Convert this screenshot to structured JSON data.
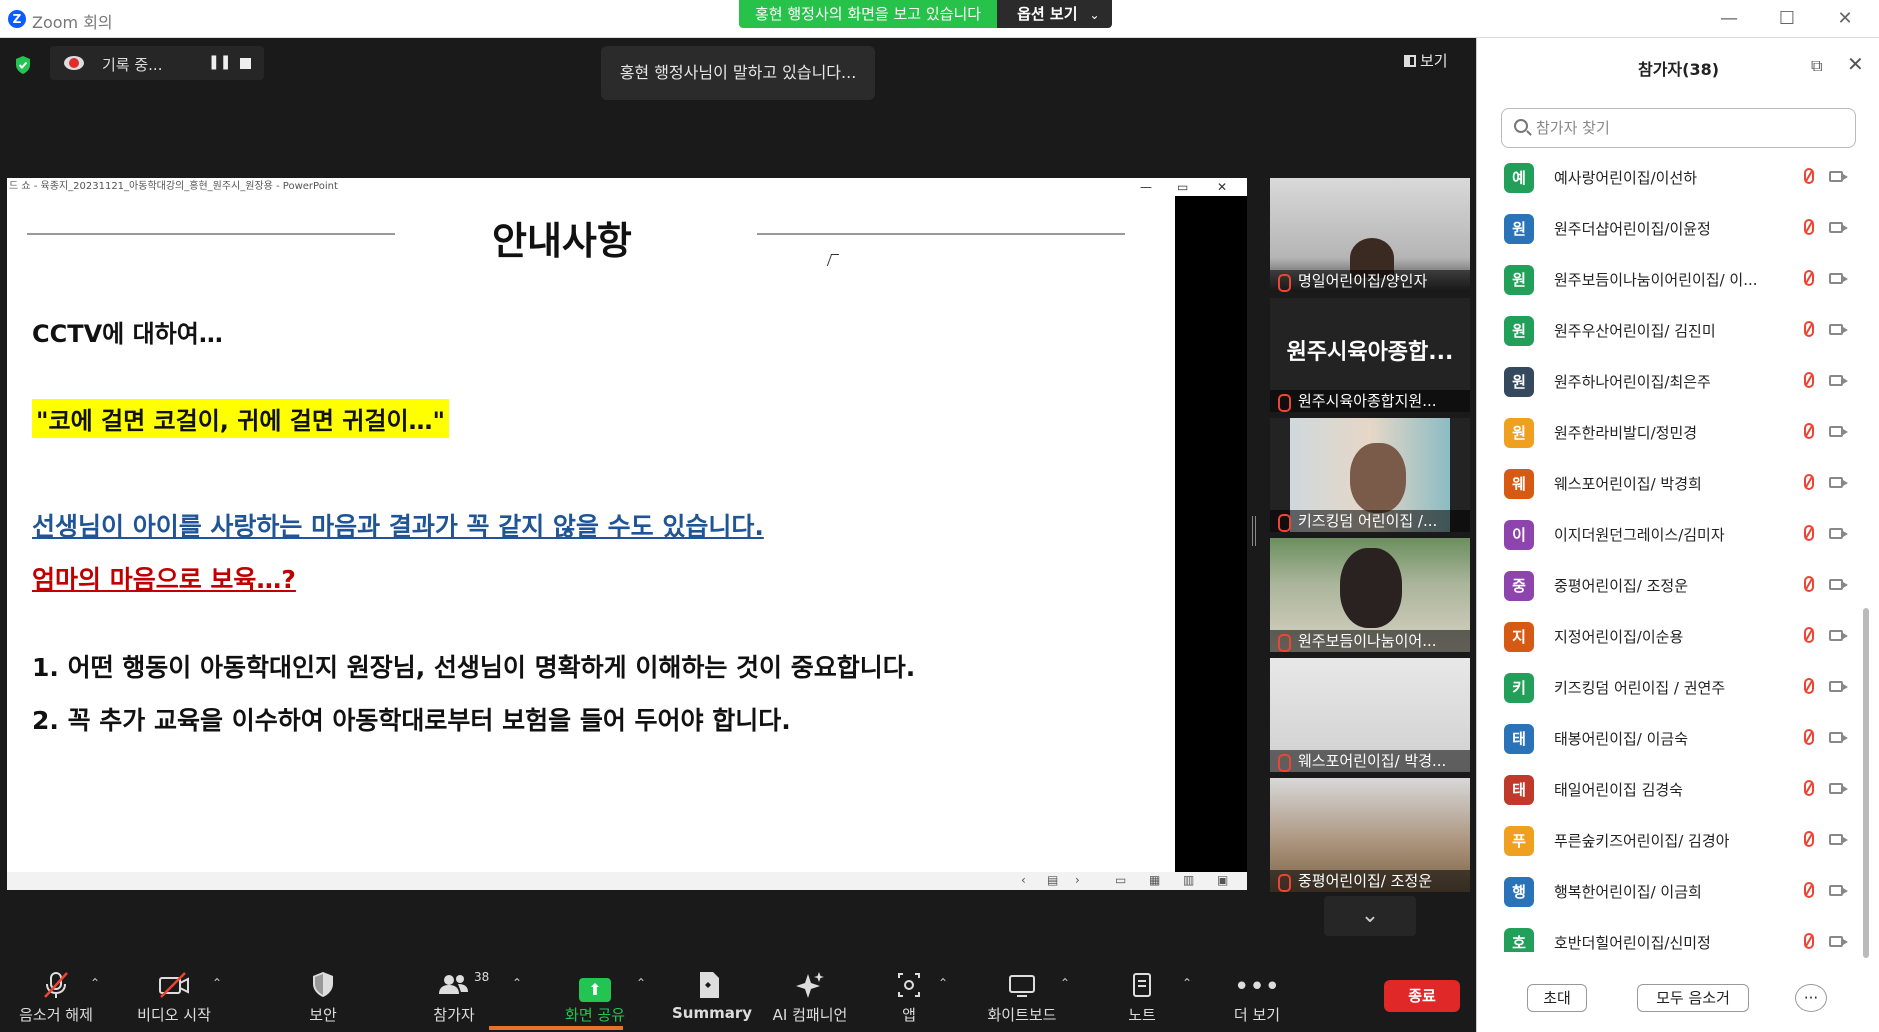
{
  "window": {
    "title": "Zoom 회의",
    "minimize": "—",
    "maximize": "☐",
    "close": "✕"
  },
  "banner": {
    "message": "홍현 행정사의 화면을 보고 있습니다",
    "options": "옵션 보기",
    "chevron": "⌄"
  },
  "recording": {
    "label": "기록 중...",
    "pause": "❚❚"
  },
  "speaking": "홍현 행정사님이 말하고 있습니다...",
  "view_button": "보기",
  "ppt": {
    "window_title": "드 쇼 - 육종지_20231121_아동학대강의_홍현_원주시_원장용 - PowerPoint",
    "ctl_min": "—",
    "ctl_max": "▭",
    "ctl_close": "✕"
  },
  "slide": {
    "heading": "안내사항",
    "line1": "CCTV에 대하여…",
    "line2": "\"코에 걸면 코걸이, 귀에 걸면 귀걸이…\"",
    "line3": "선생님이 아이를 사랑하는 마음과 결과가 꼭 같지 않을 수도 있습니다.",
    "line4": "엄마의 마음으로 보육…?",
    "line5": "1. 어떤 행동이 아동학대인지 원장님, 선생님이 명확하게 이해하는 것이 중요합니다.",
    "line6": "2. 꼭 추가 교육을 이수하여 아동학대로부터 보험을 들어 두어야 합니다."
  },
  "ppt_status": {
    "prev": "‹",
    "notes": "▤",
    "next": "›",
    "normal": "▭",
    "sorter": "▦",
    "reading": "▥",
    "slideshow": "▣"
  },
  "thumbnails": [
    {
      "name": "명일어린이집/양인자"
    },
    {
      "big": "원주시육아종합...",
      "name": "원주시육아종합지원..."
    },
    {
      "name": "키즈킹덤 어린이집 /..."
    },
    {
      "name": "원주보듬이나눔이어..."
    },
    {
      "name": "웨스포어린이집/ 박경..."
    },
    {
      "name": "중평어린이집/ 조정운"
    }
  ],
  "thumb_chevron": "⌄",
  "toolbar": {
    "mute": "음소거 해제",
    "video": "비디오 시작",
    "security": "보안",
    "participants": "참가자",
    "participants_count": "38",
    "share": "화면 공유",
    "summary": "Summary",
    "ai": "AI 컴패니언",
    "apps": "앱",
    "whiteboard": "화이트보드",
    "notes": "노트",
    "more": "더 보기",
    "end": "종료",
    "caret": "⌃"
  },
  "panel": {
    "title": "참가자(38)",
    "search_placeholder": "참가자 찾기",
    "invite": "초대",
    "mute_all": "모두 음소거",
    "more": "···"
  },
  "participants": [
    {
      "initial": "예",
      "name": "예사랑어린이집/이선하",
      "color": "#22a05a"
    },
    {
      "initial": "원",
      "name": "원주더샵어린이집/이윤정",
      "color": "#2a73b8"
    },
    {
      "initial": "원",
      "name": "원주보듬이나눔이어린이집/ 이...",
      "color": "#22a05a"
    },
    {
      "initial": "원",
      "name": "원주우산어린이집/ 김진미",
      "color": "#22a05a"
    },
    {
      "initial": "원",
      "name": "원주하나어린이집/최은주",
      "color": "#34495e"
    },
    {
      "initial": "원",
      "name": "원주한라비발디/정민경",
      "color": "#f0a020"
    },
    {
      "initial": "웨",
      "name": "웨스포어린이집/ 박경희",
      "color": "#d65a14"
    },
    {
      "initial": "이",
      "name": "이지더원던그레이스/김미자",
      "color": "#8e44ad"
    },
    {
      "initial": "중",
      "name": "중평어린이집/ 조정운",
      "color": "#8e44ad"
    },
    {
      "initial": "지",
      "name": "지정어린이집/이순용",
      "color": "#d65a14"
    },
    {
      "initial": "키",
      "name": "키즈킹덤 어린이집 / 권연주",
      "color": "#22a05a"
    },
    {
      "initial": "태",
      "name": "태봉어린이집/ 이금숙",
      "color": "#2a73b8"
    },
    {
      "initial": "태",
      "name": "태일어린이집 김경숙",
      "color": "#c0392b"
    },
    {
      "initial": "푸",
      "name": "푸른숲키즈어린이집/ 김경아",
      "color": "#f0a020"
    },
    {
      "initial": "행",
      "name": "행복한어린이집/ 이금희",
      "color": "#2a73b8"
    },
    {
      "initial": "호",
      "name": "호반더힐어린이집/신미정",
      "color": "#22a05a"
    }
  ]
}
